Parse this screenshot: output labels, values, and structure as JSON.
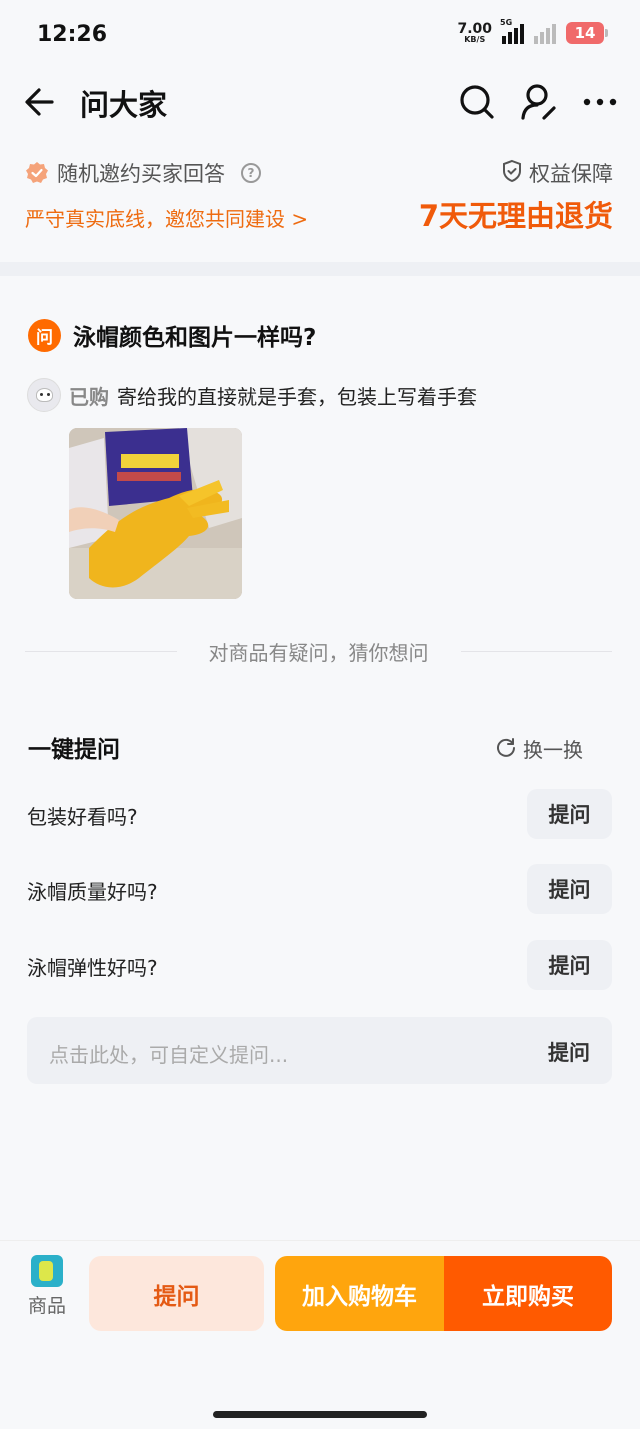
{
  "status": {
    "time": "12:26",
    "net_speed": "7.00",
    "net_unit": "KB/S",
    "net_type": "5G",
    "battery": "14"
  },
  "nav": {
    "title": "问大家",
    "icons": [
      "back-arrow-icon",
      "search-icon",
      "user-icon",
      "more-icon"
    ]
  },
  "header": {
    "invite": "随机邀约买家回答",
    "help": "?",
    "rule": "严守真实底线，邀您共同建设 >",
    "guarantee": "权益保障",
    "return_policy": "7天无理由退货"
  },
  "question": {
    "badge": "问",
    "title": "泳帽颜色和图片一样吗?",
    "answer_tag": "已购",
    "answer_text": "寄给我的直接就是手套，包装上写着手套"
  },
  "guess": {
    "label": "对商品有疑问，猜你想问"
  },
  "quick_ask": {
    "title": "一键提问",
    "refresh": "换一换",
    "items": [
      {
        "text": "包装好看吗?",
        "button": "提问"
      },
      {
        "text": "泳帽质量好吗?",
        "button": "提问"
      },
      {
        "text": "泳帽弹性好吗?",
        "button": "提问"
      }
    ],
    "input_placeholder": "点击此处，可自定义提问...",
    "input_button": "提问"
  },
  "bottom": {
    "product_label": "商品",
    "ask": "提问",
    "add_to_cart": "加入购物车",
    "buy_now": "立即购买"
  },
  "colors": {
    "accent_orange": "#ff5a00",
    "cart_yellow": "#ffa50d",
    "rule_orange": "#ee6b10"
  }
}
